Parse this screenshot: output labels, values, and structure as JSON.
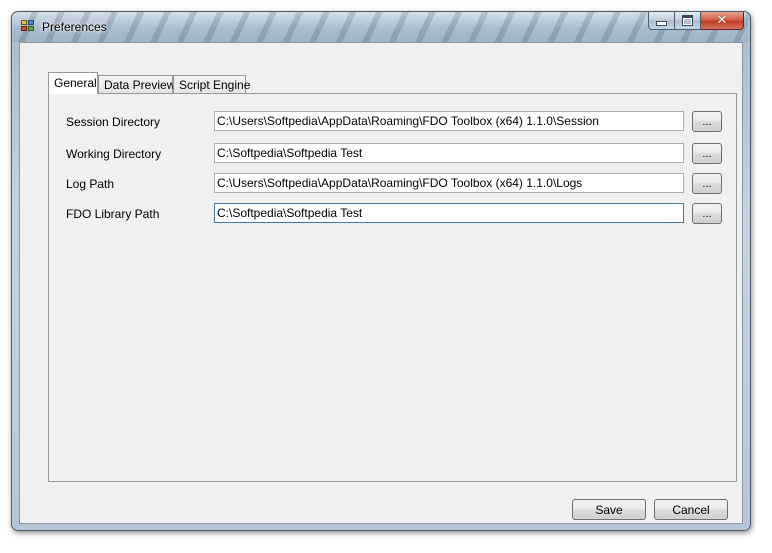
{
  "window": {
    "title": "Preferences",
    "minimize_label": "minimize",
    "maximize_label": "maximize",
    "close_label": "close"
  },
  "tabs": [
    {
      "label": "General",
      "active": true
    },
    {
      "label": "Data Preview",
      "active": false
    },
    {
      "label": "Script Engine",
      "active": false
    }
  ],
  "general": {
    "fields": [
      {
        "label": "Session Directory",
        "value": "C:\\Users\\Softpedia\\AppData\\Roaming\\FDO Toolbox (x64) 1.1.0\\Session",
        "browse_label": "..."
      },
      {
        "label": "Working Directory",
        "value": "C:\\Softpedia\\Softpedia Test",
        "browse_label": "..."
      },
      {
        "label": "Log Path",
        "value": "C:\\Users\\Softpedia\\AppData\\Roaming\\FDO Toolbox (x64) 1.1.0\\Logs",
        "browse_label": "..."
      },
      {
        "label": "FDO Library Path",
        "value": "C:\\Softpedia\\Softpedia Test",
        "browse_label": "..."
      }
    ]
  },
  "footer": {
    "save_label": "Save",
    "cancel_label": "Cancel"
  },
  "icons": {
    "app": "preferences-app-icon",
    "minimize": "minimize-icon",
    "maximize": "maximize-icon",
    "close": "close-icon"
  }
}
